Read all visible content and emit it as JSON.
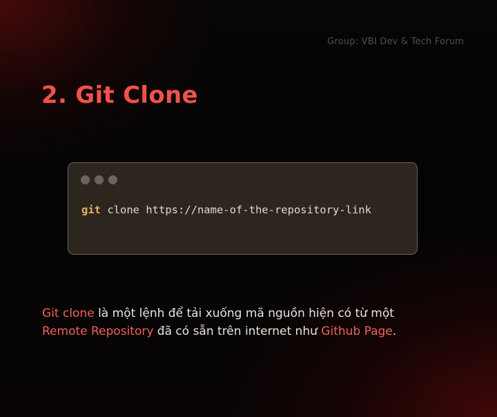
{
  "header": {
    "group_label": "Group: VBI Dev & Tech Forum"
  },
  "title": "2. Git Clone",
  "code_window": {
    "command_keyword": "git",
    "command_rest": " clone https://name-of-the-repository-link"
  },
  "description": {
    "part1": "Git clone",
    "part2": " là một lệnh để tải xuống mã nguồn hiện có từ một",
    "part3": "Remote Repository",
    "part4": " đã có sẵn trên internet như ",
    "part5": "Github Page",
    "part6": "."
  },
  "colors": {
    "accent": "#f0524a",
    "code_keyword": "#e6b45f",
    "code_bg": "#2c261f",
    "text": "#e9e4de"
  }
}
